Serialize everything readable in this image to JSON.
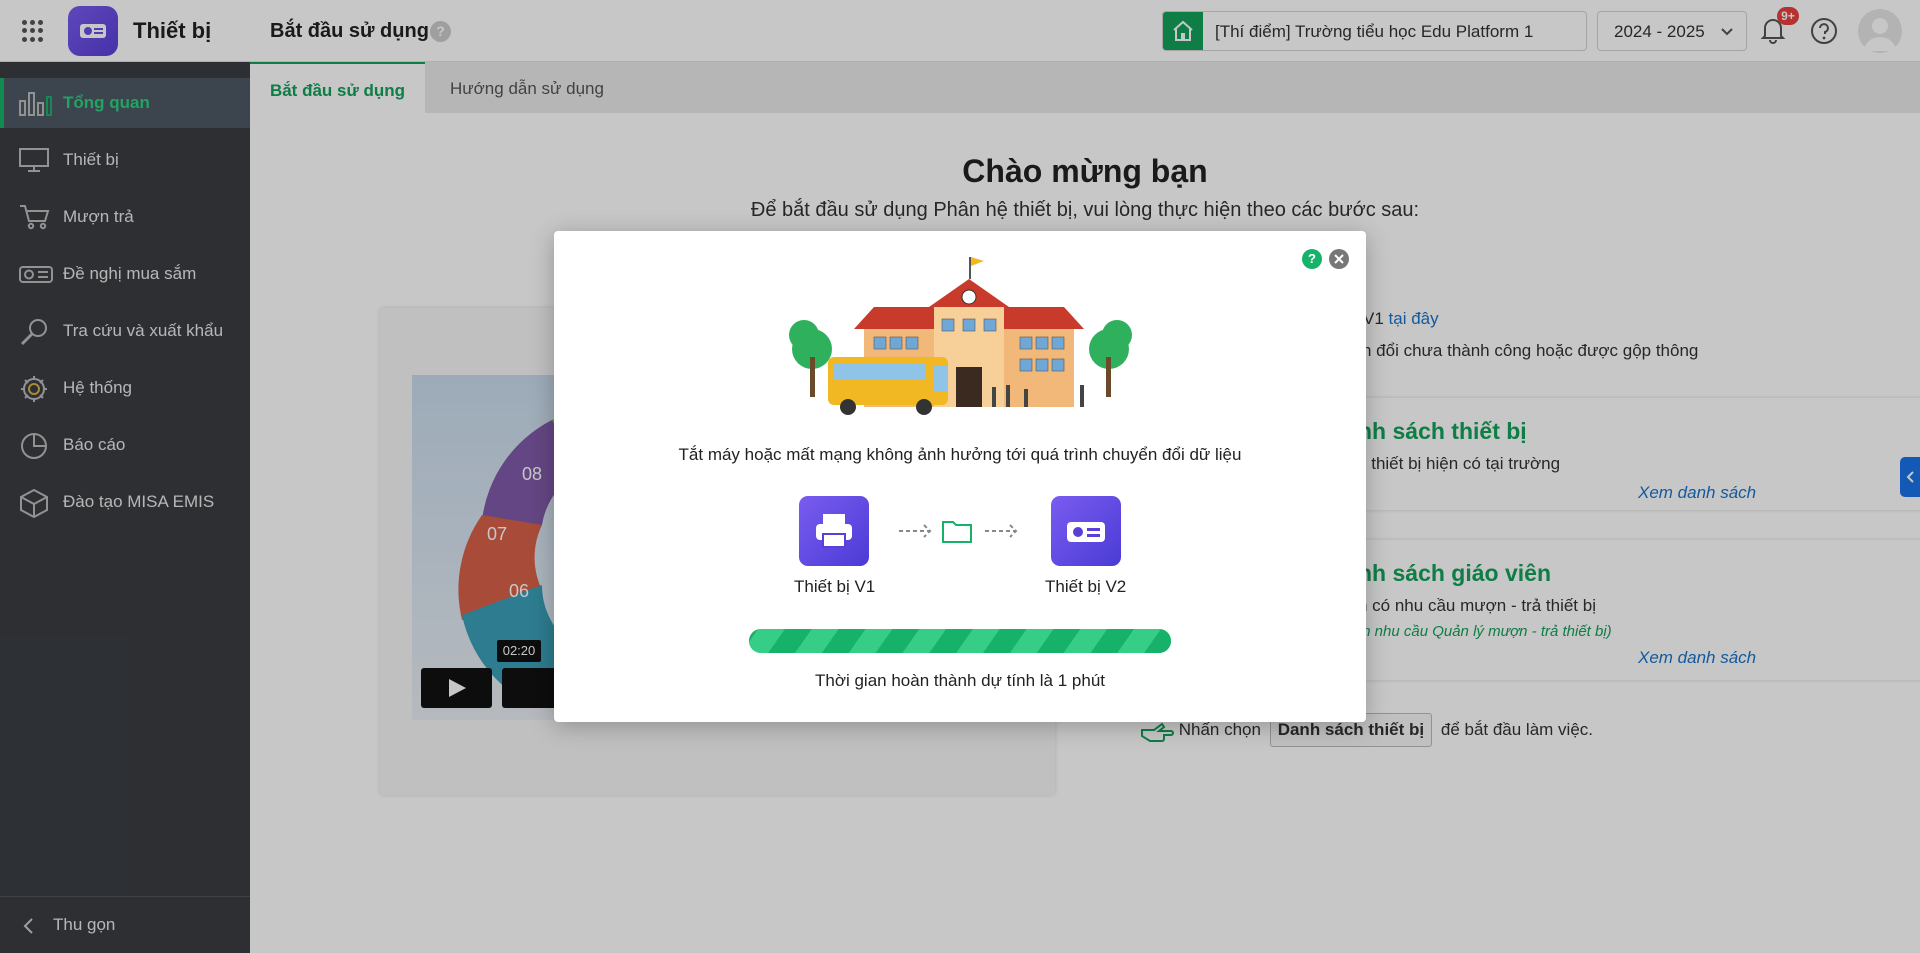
{
  "header": {
    "app_title": "Thiết bị",
    "page_title": "Bắt đầu sử dụng",
    "help_badge": "?",
    "school": "[Thí điểm] Trường tiểu học Edu Platform 1",
    "school_year": "2024 - 2025",
    "notification_count": "9+"
  },
  "sidebar": {
    "items": [
      {
        "label": "Tổng quan",
        "icon": "bar-chart-icon",
        "active": true
      },
      {
        "label": "Thiết bị",
        "icon": "monitor-icon"
      },
      {
        "label": "Mượn trả",
        "icon": "cart-icon"
      },
      {
        "label": "Đề nghị mua sắm",
        "icon": "projector-icon"
      },
      {
        "label": "Tra cứu và xuất khẩu",
        "icon": "magnifier-icon"
      },
      {
        "label": "Hệ thống",
        "icon": "gear-icon"
      },
      {
        "label": "Báo cáo",
        "icon": "pie-chart-icon"
      },
      {
        "label": "Đào tạo MISA EMIS",
        "icon": "cube-icon"
      }
    ],
    "collapse_label": "Thu gọn"
  },
  "tabs": [
    {
      "label": "Bắt đầu sử dụng",
      "active": true
    },
    {
      "label": "Hướng dẫn sử dụng"
    }
  ],
  "main": {
    "welcome": "Chào mừng bạn",
    "subtitle": "Để bắt đầu sử dụng Phân hệ thiết bị, vui lòng thực hiện theo các bước sau:",
    "video_time": "02:20",
    "video_segments": [
      "08",
      "07",
      "06"
    ],
    "step1_partial": "V1",
    "step1_link": "tại đây",
    "step1_note_partial": "n đổi chưa thành công hoặc được gộp thông",
    "card_devices": {
      "title_partial": "nh sách thiết bị",
      "text_partial": "c thiết bị hiện có tại trường",
      "link": "Xem danh sách"
    },
    "card_teachers": {
      "title_partial": "nh sách giáo viên",
      "text_partial": "n có nhu cầu mượn - trả thiết bị",
      "note_partial": "m nhu cầu Quản lý mượn - trả thiết bị)",
      "link": "Xem danh sách"
    },
    "hint_prefix": "Nhấn chọn",
    "hint_button": "Danh sách thiết bị",
    "hint_suffix": "để bắt đầu làm việc."
  },
  "modal": {
    "help": "?",
    "message": "Tắt máy hoặc mất mạng không ảnh hưởng tới quá trình chuyển đổi dữ liệu",
    "source_label": "Thiết bị V1",
    "target_label": "Thiết bị V2",
    "progress": 1.0,
    "eta": "Thời gian hoàn thành dự tính là 1 phút"
  },
  "colors": {
    "brand_green": "#12a05a",
    "brand_purple": "#6a4ee6",
    "sidebar_bg": "#3a3d42",
    "link_blue": "#1a73c9"
  }
}
